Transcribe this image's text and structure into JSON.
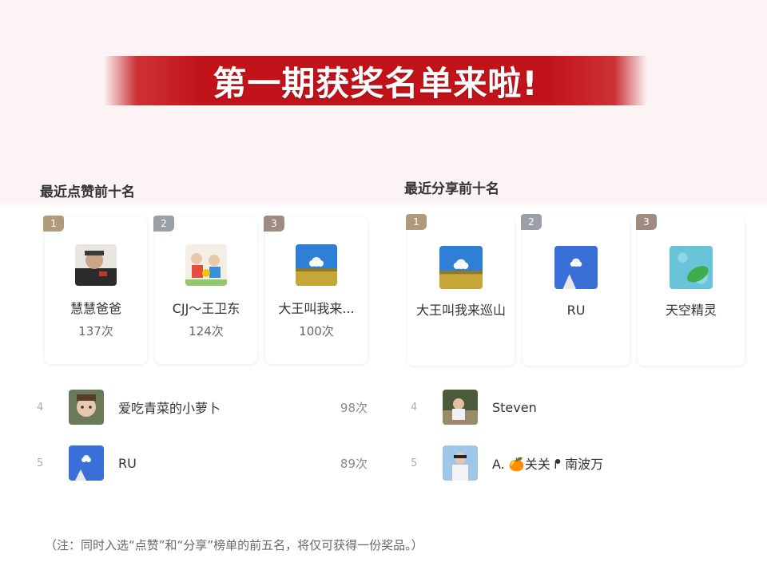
{
  "banner": {
    "title": "第一期获奖名单来啦!"
  },
  "likes": {
    "title": "最近点赞前十名",
    "top": [
      {
        "rank": "1",
        "name": "慧慧爸爸",
        "count": "137次"
      },
      {
        "rank": "2",
        "name": "CJJ～王卫东",
        "count": "124次"
      },
      {
        "rank": "3",
        "name": "大王叫我来...",
        "count": "100次"
      }
    ],
    "rows": [
      {
        "rank": "4",
        "name": "爱吃青菜的小萝卜",
        "count": "98次"
      },
      {
        "rank": "5",
        "name": "RU",
        "count": "89次"
      }
    ]
  },
  "shares": {
    "title": "最近分享前十名",
    "top": [
      {
        "rank": "1",
        "name": "大王叫我来巡山"
      },
      {
        "rank": "2",
        "name": "RU"
      },
      {
        "rank": "3",
        "name": "天空精灵"
      }
    ],
    "rows": [
      {
        "rank": "4",
        "name": "Steven"
      },
      {
        "rank": "5",
        "name": "A. 🍊关关 ᖰ 南波万"
      }
    ]
  },
  "note": "（注：同时入选“点赞”和“分享”榜单的前五名，将仅可获得一份奖品。）"
}
